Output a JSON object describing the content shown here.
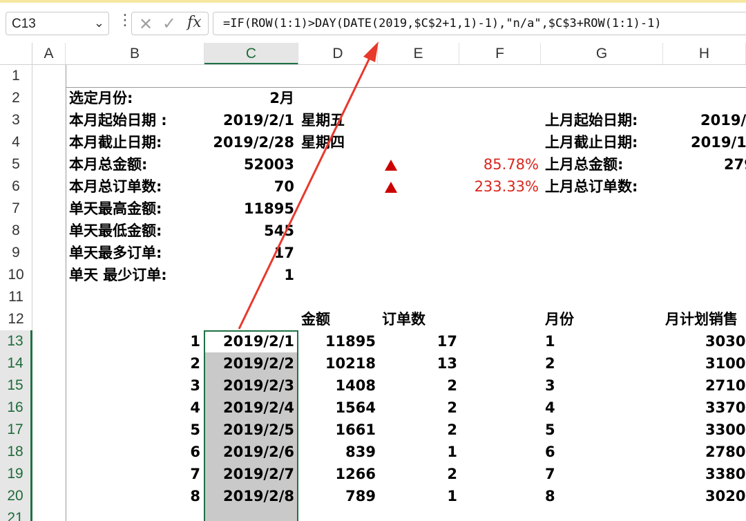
{
  "formula_bar": {
    "name_box": "C13",
    "formula": "=IF(ROW(1:1)>DAY(DATE(2019,$C$2+1,1)-1),\"n/a\",$C$3+ROW(1:1)-1)"
  },
  "columns": [
    "A",
    "B",
    "C",
    "D",
    "E",
    "F",
    "G",
    "H"
  ],
  "rows": [
    "1",
    "2",
    "3",
    "4",
    "5",
    "6",
    "7",
    "8",
    "9",
    "10",
    "11",
    "12",
    "13",
    "14",
    "15",
    "16",
    "17",
    "18",
    "19",
    "20",
    "21"
  ],
  "summary": {
    "selected_month_label": "选定月份:",
    "selected_month_value": "2月",
    "start_label": "本月起始日期 :",
    "start_value": "2019/2/1",
    "start_weekday": "星期五",
    "end_label": "本月截止日期:",
    "end_value": "2019/2/28",
    "end_weekday": "星期四",
    "total_amount_label": "本月总金额:",
    "total_amount_value": "52003",
    "total_orders_label": "本月总订单数:",
    "total_orders_value": "70",
    "max_amount_label": "单天最高金额:",
    "max_amount_value": "11895",
    "min_amount_label": "单天最低金额:",
    "min_amount_value": "545",
    "max_orders_label": "单天最多订单:",
    "max_orders_value": "17",
    "min_orders_label": "单天 最少订单:",
    "min_orders_value": "1",
    "amount_change": "85.78%",
    "orders_change": "233.33%",
    "prev_start_label": "上月起始日期:",
    "prev_start_value": "2019/",
    "prev_end_label": "上月截止日期:",
    "prev_end_value": "2019/1",
    "prev_total_amount_label": "上月总金额:",
    "prev_total_amount_value": "279",
    "prev_total_orders_label": "上月总订单数:"
  },
  "table_headers": {
    "amount": "金额",
    "orders": "订单数",
    "month": "月份",
    "plan": "月计划销售"
  },
  "daily": [
    {
      "idx": "1",
      "date": "2019/2/1",
      "amount": "11895",
      "orders": "17",
      "month": "1",
      "plan": "3030"
    },
    {
      "idx": "2",
      "date": "2019/2/2",
      "amount": "10218",
      "orders": "13",
      "month": "2",
      "plan": "3100"
    },
    {
      "idx": "3",
      "date": "2019/2/3",
      "amount": "1408",
      "orders": "2",
      "month": "3",
      "plan": "2710"
    },
    {
      "idx": "4",
      "date": "2019/2/4",
      "amount": "1564",
      "orders": "2",
      "month": "4",
      "plan": "3370"
    },
    {
      "idx": "5",
      "date": "2019/2/5",
      "amount": "1661",
      "orders": "2",
      "month": "5",
      "plan": "3300"
    },
    {
      "idx": "6",
      "date": "2019/2/6",
      "amount": "839",
      "orders": "1",
      "month": "6",
      "plan": "2780"
    },
    {
      "idx": "7",
      "date": "2019/2/7",
      "amount": "1266",
      "orders": "2",
      "month": "7",
      "plan": "3380"
    },
    {
      "idx": "8",
      "date": "2019/2/8",
      "amount": "789",
      "orders": "1",
      "month": "8",
      "plan": "3020"
    }
  ],
  "colors": {
    "selection_green": "#1e7145",
    "arrow_red": "#e8392c",
    "up_red": "#cc0000"
  }
}
